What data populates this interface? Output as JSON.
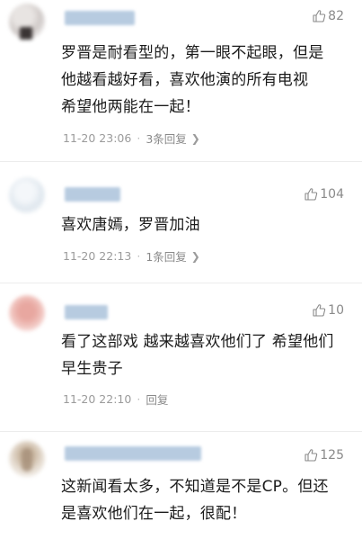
{
  "comments": [
    {
      "likes": "82",
      "lines": [
        "罗晋是耐看型的，第一眼不起眼，但是",
        "他越看越好看，喜欢他演的所有电视",
        "希望他两能在一起！"
      ],
      "time": "11-20 23:06",
      "reply": "3条回复",
      "has_chevron": true
    },
    {
      "likes": "104",
      "lines": [
        "喜欢唐嫣，罗晋加油"
      ],
      "time": "11-20 22:13",
      "reply": "1条回复",
      "has_chevron": true
    },
    {
      "likes": "10",
      "lines": [
        "看了这部戏 越来越喜欢他们了 希望他们",
        "早生贵子"
      ],
      "time": "11-20 22:10",
      "reply": "回复",
      "has_chevron": false
    },
    {
      "likes": "125",
      "lines": [
        "这新闻看太多，不知道是不是CP。但还",
        "是喜欢他们在一起，很配！"
      ],
      "time": "",
      "reply": "",
      "has_chevron": false
    }
  ],
  "icons": {
    "like": "thumbs-up-icon",
    "chevron": "chevron-right-icon"
  },
  "colors": {
    "username_blur": "#b7cbe0",
    "text": "#1b1b1b",
    "meta": "#9b9b9b"
  }
}
